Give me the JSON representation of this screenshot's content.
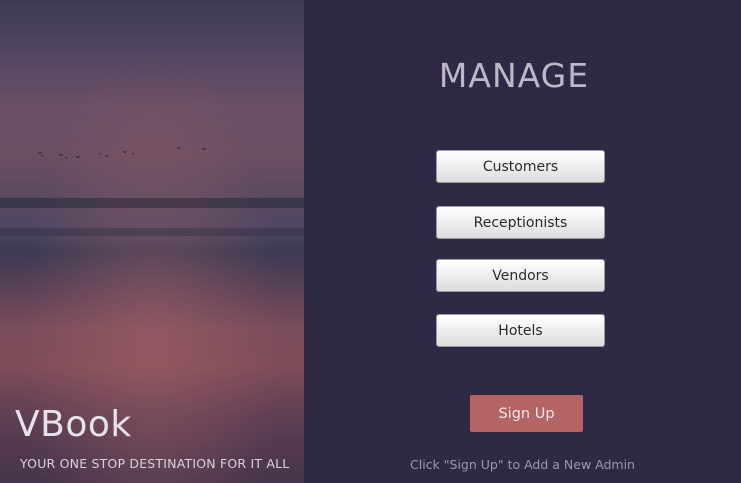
{
  "brand": {
    "title": "VBook",
    "tagline": "YOUR ONE STOP DESTINATION FOR IT ALL"
  },
  "main": {
    "heading": "MANAGE",
    "buttons": [
      {
        "label": "Customers"
      },
      {
        "label": "Receptionists"
      },
      {
        "label": "Vendors"
      },
      {
        "label": "Hotels"
      }
    ],
    "signup_label": "Sign Up",
    "hint": "Click \"Sign Up\" to Add a New Admin"
  },
  "colors": {
    "background": "#2f2946",
    "signup_button": "#b56464",
    "heading": "#bdb8c8"
  }
}
